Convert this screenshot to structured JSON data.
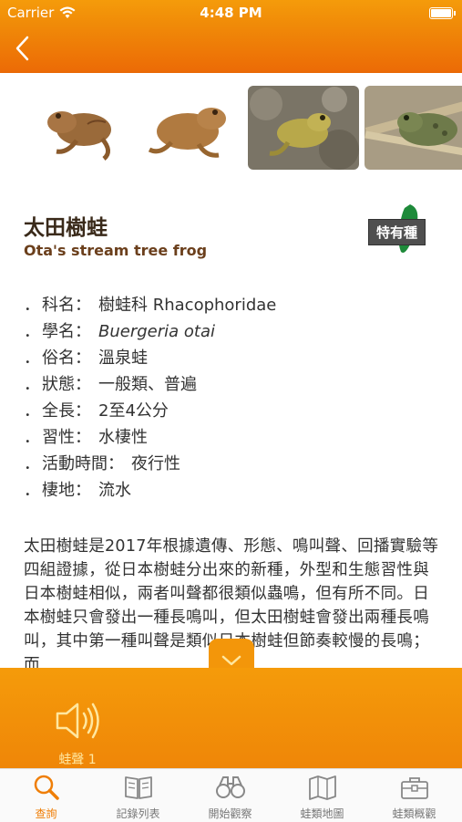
{
  "status_bar": {
    "carrier": "Carrier",
    "time": "4:48 PM"
  },
  "nav": {
    "back_icon": "chevron-left-icon"
  },
  "gallery": {
    "photos": [
      "frog-photo-1",
      "frog-photo-2",
      "frog-photo-3",
      "frog-photo-4"
    ]
  },
  "species": {
    "name_zh": "太田樹蛙",
    "name_en": "Ota's stream tree frog",
    "endemic_badge": "特有種",
    "facts": [
      {
        "bullet": "．",
        "label": "科名：",
        "value": "樹蛙科 Rhacophoridae"
      },
      {
        "bullet": "．",
        "label": "學名：",
        "value": "Buergeria otai"
      },
      {
        "bullet": "．",
        "label": "俗名：",
        "value": "溫泉蛙"
      },
      {
        "bullet": "．",
        "label": "狀態：",
        "value": "一般類、普遍"
      },
      {
        "bullet": "．",
        "label": "全長：",
        "value": "2至4公分"
      },
      {
        "bullet": "．",
        "label": "習性：",
        "value": "水棲性"
      },
      {
        "bullet": "．",
        "label": "活動時間：",
        "value": "夜行性"
      },
      {
        "bullet": "．",
        "label": "棲地：",
        "value": "流水"
      }
    ],
    "description": "太田樹蛙是2017年根據遺傳、形態、鳴叫聲、回播實驗等四組證據，從日本樹蛙分出來的新種，外型和生態習性與日本樹蛙相似，兩者叫聲都很類似蟲鳴，但有所不同。日本樹蛙只會發出一種長鳴叫，但太田樹蛙會發出兩種長鳴叫，其中第一種叫聲是類似日本樹蛙但節奏較慢的長鳴；而"
  },
  "sound": {
    "label": "蛙聲 1",
    "icon": "speaker-icon"
  },
  "tabs": [
    {
      "label": "查詢",
      "icon": "search-icon",
      "active": true
    },
    {
      "label": "記錄列表",
      "icon": "book-icon",
      "active": false
    },
    {
      "label": "開始觀察",
      "icon": "binoculars-icon",
      "active": false
    },
    {
      "label": "蛙類地圖",
      "icon": "map-icon",
      "active": false
    },
    {
      "label": "蛙類概觀",
      "icon": "toolbox-icon",
      "active": false
    }
  ],
  "colors": {
    "accent": "#ef7e07",
    "nav_top": "#f59b0a",
    "nav_bottom": "#ec6a06",
    "badge_bg": "#4f4f4f",
    "taiwan_green": "#1e8a3a"
  }
}
